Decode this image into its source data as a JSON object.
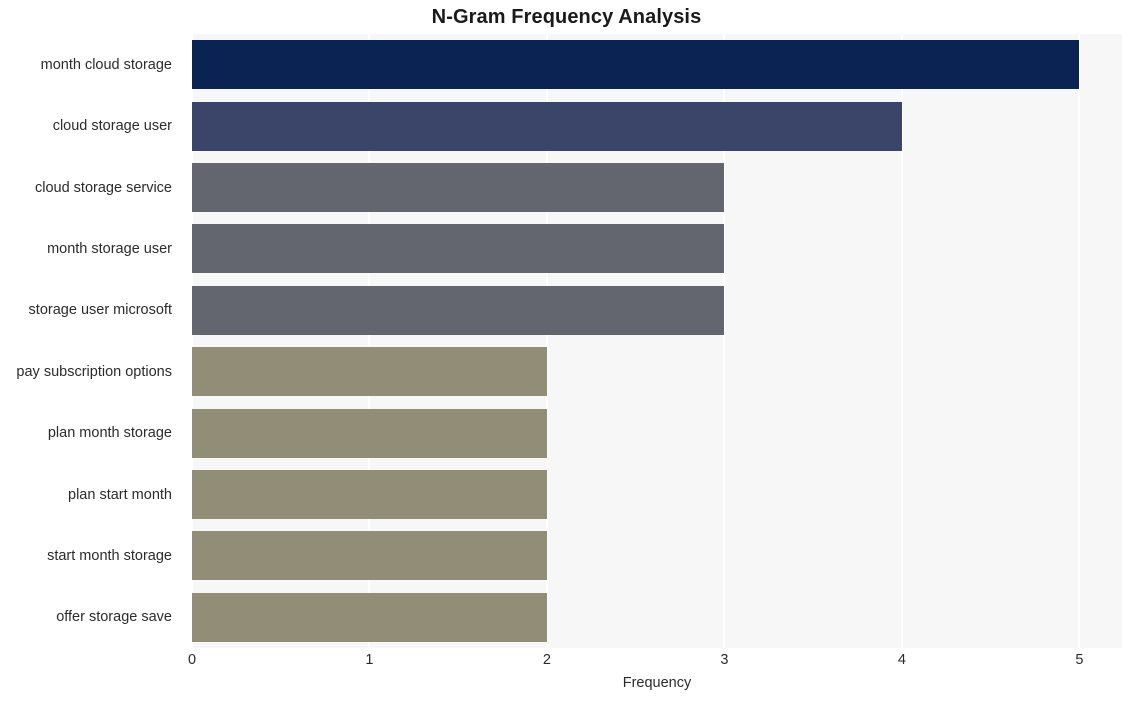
{
  "chart_data": {
    "type": "bar",
    "orientation": "horizontal",
    "title": "N-Gram Frequency Analysis",
    "xlabel": "Frequency",
    "ylabel": "",
    "xlim": [
      0,
      5.24
    ],
    "xticks": [
      "0",
      "1",
      "2",
      "3",
      "4",
      "5"
    ],
    "xtick_values": [
      0,
      1,
      2,
      3,
      4,
      5
    ],
    "grid": true,
    "legend": null,
    "categories": [
      "month cloud storage",
      "cloud storage user",
      "cloud storage service",
      "month storage user",
      "storage user microsoft",
      "pay subscription options",
      "plan month storage",
      "plan start month",
      "start month storage",
      "offer storage save"
    ],
    "values": [
      5,
      4,
      3,
      3,
      3,
      2,
      2,
      2,
      2,
      2
    ],
    "bar_colors": [
      "#0a2352",
      "#3a4569",
      "#63666f",
      "#63666f",
      "#63666f",
      "#928d76",
      "#928d76",
      "#928d76",
      "#928d76",
      "#928d76"
    ],
    "plot_background": "#f7f7f8",
    "gridline_color": "#ffffff",
    "figure_background": "#ffffff",
    "text_color": "#2b2b2b",
    "title_color": "#1a1a1a"
  }
}
